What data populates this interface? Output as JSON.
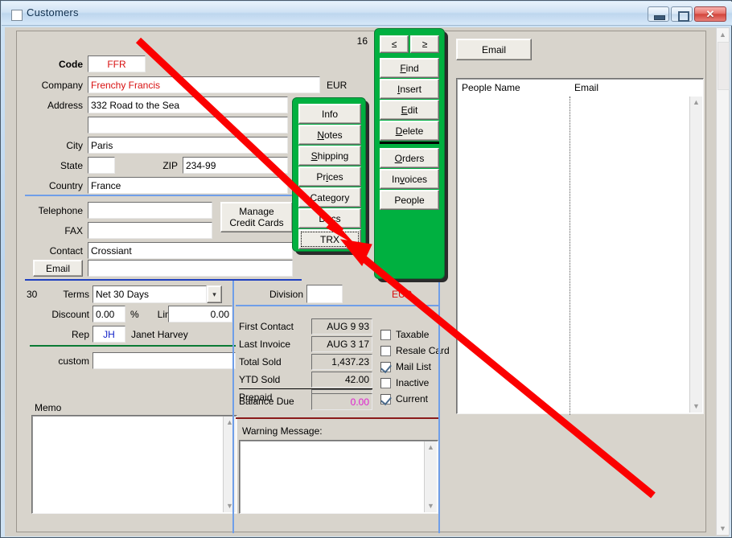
{
  "window": {
    "title": "Customers",
    "minimize_label": "–",
    "maximize_label": "□",
    "close_label": "✕"
  },
  "header": {
    "record_count": "16",
    "currency_top": "EUR",
    "currency_mid": "EUR"
  },
  "fields": {
    "code_label": "Code",
    "code_value": "FFR",
    "company_label": "Company",
    "company_value": "Frenchy Francis",
    "address_label": "Address",
    "address_value": "332 Road to the Sea",
    "address2_value": "",
    "city_label": "City",
    "city_value": "Paris",
    "state_label": "State",
    "state_value": "",
    "zip_label": "ZIP",
    "zip_value": "234-99",
    "country_label": "Country",
    "country_value": "France",
    "telephone_label": "Telephone",
    "telephone_value": "",
    "fax_label": "FAX",
    "fax_value": "",
    "contact_label": "Contact",
    "contact_value": "Crossiant",
    "email_button_label": "Email",
    "email_value": "",
    "manage_credit_cards_label": "Manage\nCredit Cards"
  },
  "terms": {
    "days": "30",
    "terms_label": "Terms",
    "terms_value": "Net 30 Days",
    "discount_label": "Discount",
    "discount_value": "0.00",
    "percent_label": "%",
    "limit_label": "Limit",
    "limit_value": "0.00",
    "rep_label": "Rep",
    "rep_code": "JH",
    "rep_name": "Janet Harvey",
    "custom_label": "custom",
    "custom_value": ""
  },
  "memo": {
    "label": "Memo",
    "value": ""
  },
  "division": {
    "label": "Division",
    "value": ""
  },
  "summary": {
    "rows": [
      {
        "label": "First Contact",
        "value": "AUG 9 93"
      },
      {
        "label": "Last Invoice",
        "value": "AUG 3 17"
      },
      {
        "label": "Total Sold",
        "value": "1,437.23"
      },
      {
        "label": "YTD Sold",
        "value": "42.00"
      },
      {
        "label": "Prepaid",
        "value": "0.00"
      }
    ],
    "balance_label": "Balance Due",
    "balance_value": "0.00"
  },
  "checkboxes": [
    {
      "label": "Taxable",
      "checked": false
    },
    {
      "label": "Resale Card",
      "checked": false
    },
    {
      "label": "Mail List",
      "checked": true
    },
    {
      "label": "Inactive",
      "checked": false
    },
    {
      "label": "Current",
      "checked": true
    }
  ],
  "warning": {
    "label": "Warning Message:",
    "value": ""
  },
  "tab_buttons": [
    {
      "label": "Info",
      "mnemonic": "",
      "focused": false
    },
    {
      "label": "Notes",
      "mnemonic": "N",
      "focused": false
    },
    {
      "label": "Shipping",
      "mnemonic": "S",
      "focused": false
    },
    {
      "label": "Prices",
      "mnemonic": "i",
      "focused": false
    },
    {
      "label": "Category",
      "mnemonic": "",
      "focused": false
    },
    {
      "label": "Docs",
      "mnemonic": "",
      "focused": false
    },
    {
      "label": "TRX",
      "mnemonic": "",
      "focused": true
    }
  ],
  "nav_buttons": {
    "prev_label": "≤",
    "next_label": "≥",
    "actions": [
      {
        "label": "Find",
        "mnemonic": "F"
      },
      {
        "label": "Insert",
        "mnemonic": "I"
      },
      {
        "label": "Edit",
        "mnemonic": "E"
      },
      {
        "label": "Delete",
        "mnemonic": "D"
      }
    ],
    "related": [
      {
        "label": "Orders",
        "mnemonic": "O"
      },
      {
        "label": "Invoices",
        "mnemonic": "v"
      },
      {
        "label": "People",
        "mnemonic": ""
      }
    ]
  },
  "people_panel": {
    "email_button_label": "Email",
    "columns": [
      "People Name",
      "Email"
    ],
    "rows": []
  },
  "colors": {
    "group_green": "#00b040",
    "accent_red": "#d81010",
    "annotation_red": "#fb0000",
    "divider_blue": "#6f9ee8",
    "divider_darkblue": "#2040c0",
    "divider_green": "#0a7a34",
    "divider_darkred": "#8b1a1a",
    "magenta": "#e020d0",
    "rep_blue": "#1020c8"
  }
}
